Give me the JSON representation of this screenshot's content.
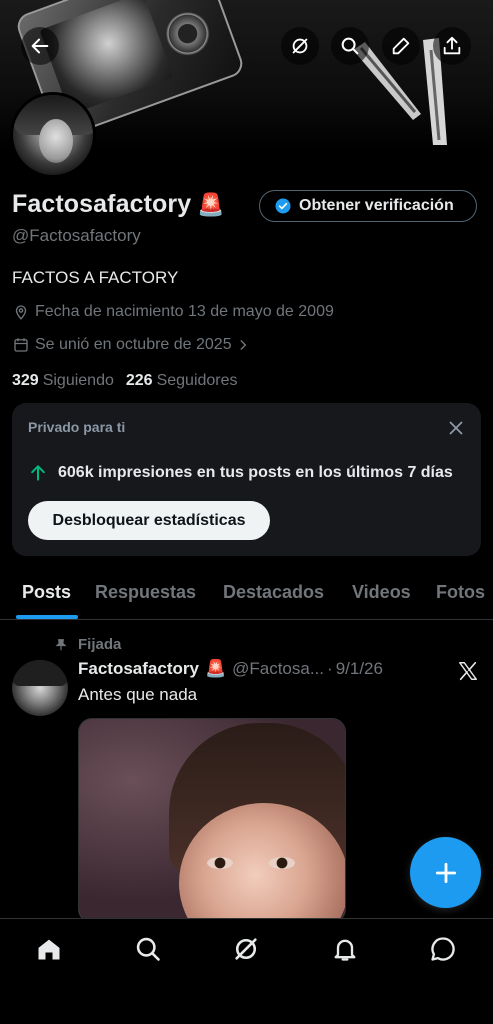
{
  "profile": {
    "display_name": "Factosafactory",
    "name_emoji": "🚨",
    "handle": "@Factosafactory",
    "bio": "FACTOS A FACTORY",
    "birthdate": "Fecha de nacimiento 13 de mayo de 2009",
    "joined": "Se unió en octubre de 2025",
    "following_count": "329",
    "following_label": "Siguiendo",
    "followers_count": "226",
    "followers_label": "Seguidores",
    "verify_button": "Obtener verificación"
  },
  "top_bar": {
    "icons": [
      "back-arrow-icon",
      "grok-icon",
      "search-icon",
      "edit-pencil-icon",
      "share-icon"
    ]
  },
  "stats_card": {
    "title": "Privado para ti",
    "message": "606k impresiones en tus posts en los últimos 7 días",
    "button": "Desbloquear estadísticas"
  },
  "tabs": [
    {
      "label": "Posts",
      "active": true
    },
    {
      "label": "Respuestas",
      "active": false
    },
    {
      "label": "Destacados",
      "active": false
    },
    {
      "label": "Videos",
      "active": false
    },
    {
      "label": "Fotos",
      "active": false
    }
  ],
  "post": {
    "pinned_label": "Fijada",
    "author_name": "Factosafactory",
    "author_emoji": "🚨",
    "author_handle_truncated": "@Factosa...",
    "date": "9/1/26",
    "text": "Antes que nada"
  },
  "bottom_nav": [
    "home-icon",
    "search-icon",
    "grok-icon",
    "notifications-bell-icon",
    "messages-icon"
  ],
  "colors": {
    "background": "#000000",
    "accent": "#1d9bf0",
    "secondary_text": "#71767b",
    "card_bg": "#16181c",
    "growth_green": "#00ba7c"
  }
}
